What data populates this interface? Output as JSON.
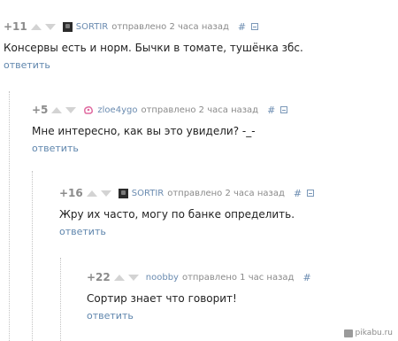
{
  "comments": [
    {
      "rating": "+11",
      "username": "SORTIR",
      "meta": "отправлено 2 часа назад",
      "hash": "#",
      "text": "Консервы есть и норм. Бычки в томате, тушёнка збс.",
      "reply": "ответить",
      "avatar": "dark-avatar-icon"
    },
    {
      "rating": "+5",
      "username": "zloe4ygo",
      "meta": "отправлено 2 часа назад",
      "hash": "#",
      "text": "Мне интересно, как вы это увидели? -_-",
      "reply": "ответить",
      "avatar": "pink-avatar-icon"
    },
    {
      "rating": "+16",
      "username": "SORTIR",
      "meta": "отправлено 2 часа назад",
      "hash": "#",
      "text": "Жру их часто, могу по банке определить.",
      "reply": "ответить",
      "avatar": "dark-avatar-icon"
    },
    {
      "rating": "+22",
      "username": "noobby",
      "meta": "отправлено 1 час назад",
      "hash": "#",
      "text": "Сортир знает что говорит!",
      "reply": "ответить",
      "avatar": "none"
    }
  ],
  "watermark": "pikabu.ru",
  "colors": {
    "link": "#5f86ad",
    "username": "#6a8bb0",
    "meta": "#8a8a8a",
    "text": "#222222",
    "rating": "#8b8b8b"
  }
}
